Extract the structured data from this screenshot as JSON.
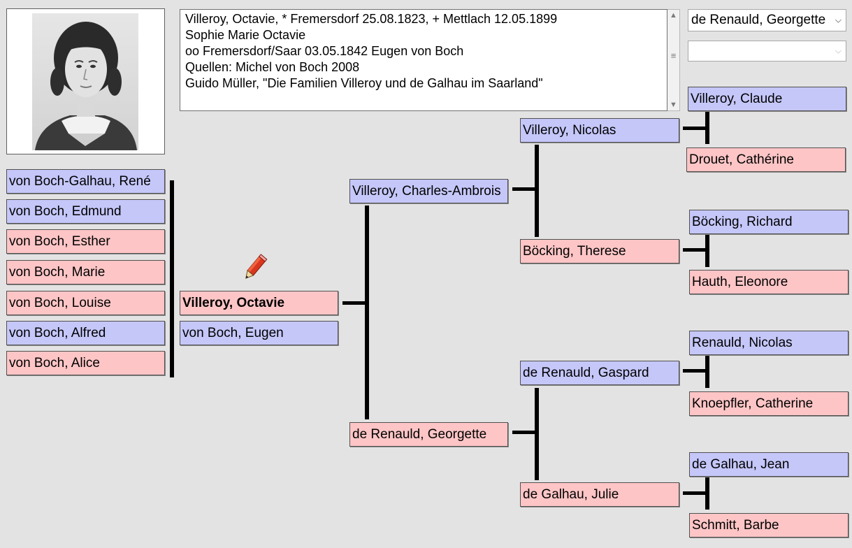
{
  "notes": {
    "lines": [
      "Villeroy, Octavie, * Fremersdorf 25.08.1823, + Mettlach 12.05.1899",
      "Sophie Marie Octavie",
      "oo Fremersdorf/Saar 03.05.1842 Eugen von Boch",
      "Quellen: Michel von Boch 2008",
      "Guido Müller, \"Die Familien Villeroy und de Galhau im Saarland\""
    ]
  },
  "selectors": {
    "primary": "de Renauld, Georgette",
    "secondary": ""
  },
  "children": [
    {
      "name": "von Boch-Galhau, René",
      "sex": "m"
    },
    {
      "name": "von Boch, Edmund",
      "sex": "m"
    },
    {
      "name": "von Boch, Esther",
      "sex": "f"
    },
    {
      "name": "von Boch, Marie",
      "sex": "f"
    },
    {
      "name": "von Boch, Louise",
      "sex": "f"
    },
    {
      "name": "von Boch, Alfred",
      "sex": "m"
    },
    {
      "name": "von Boch, Alice",
      "sex": "f"
    }
  ],
  "focus": {
    "person": "Villeroy, Octavie",
    "spouse": "von Boch, Eugen"
  },
  "parents": {
    "father": "Villeroy, Charles-Ambrois",
    "mother": "de Renauld, Georgette"
  },
  "grandparents": {
    "paternal_grandfather": "Villeroy, Nicolas",
    "paternal_grandmother": "Böcking, Therese",
    "maternal_grandfather": "de Renauld, Gaspard",
    "maternal_grandmother": "de Galhau, Julie"
  },
  "great_grandparents": {
    "pgf_father": "Villeroy, Claude",
    "pgf_mother": "Drouet, Cathérine",
    "pgm_father": "Böcking, Richard",
    "pgm_mother": "Hauth, Eleonore",
    "mgf_father": "Renauld, Nicolas",
    "mgf_mother": "Knoepfler, Catherine",
    "mgm_father": "de Galhau, Jean",
    "mgm_mother": "Schmitt, Barbe"
  },
  "colors": {
    "male": "#c5c7f9",
    "female": "#fdc5c6",
    "background": "#e4e3e3"
  },
  "icons": [
    "pencil-edit-icon",
    "portrait-photo"
  ]
}
